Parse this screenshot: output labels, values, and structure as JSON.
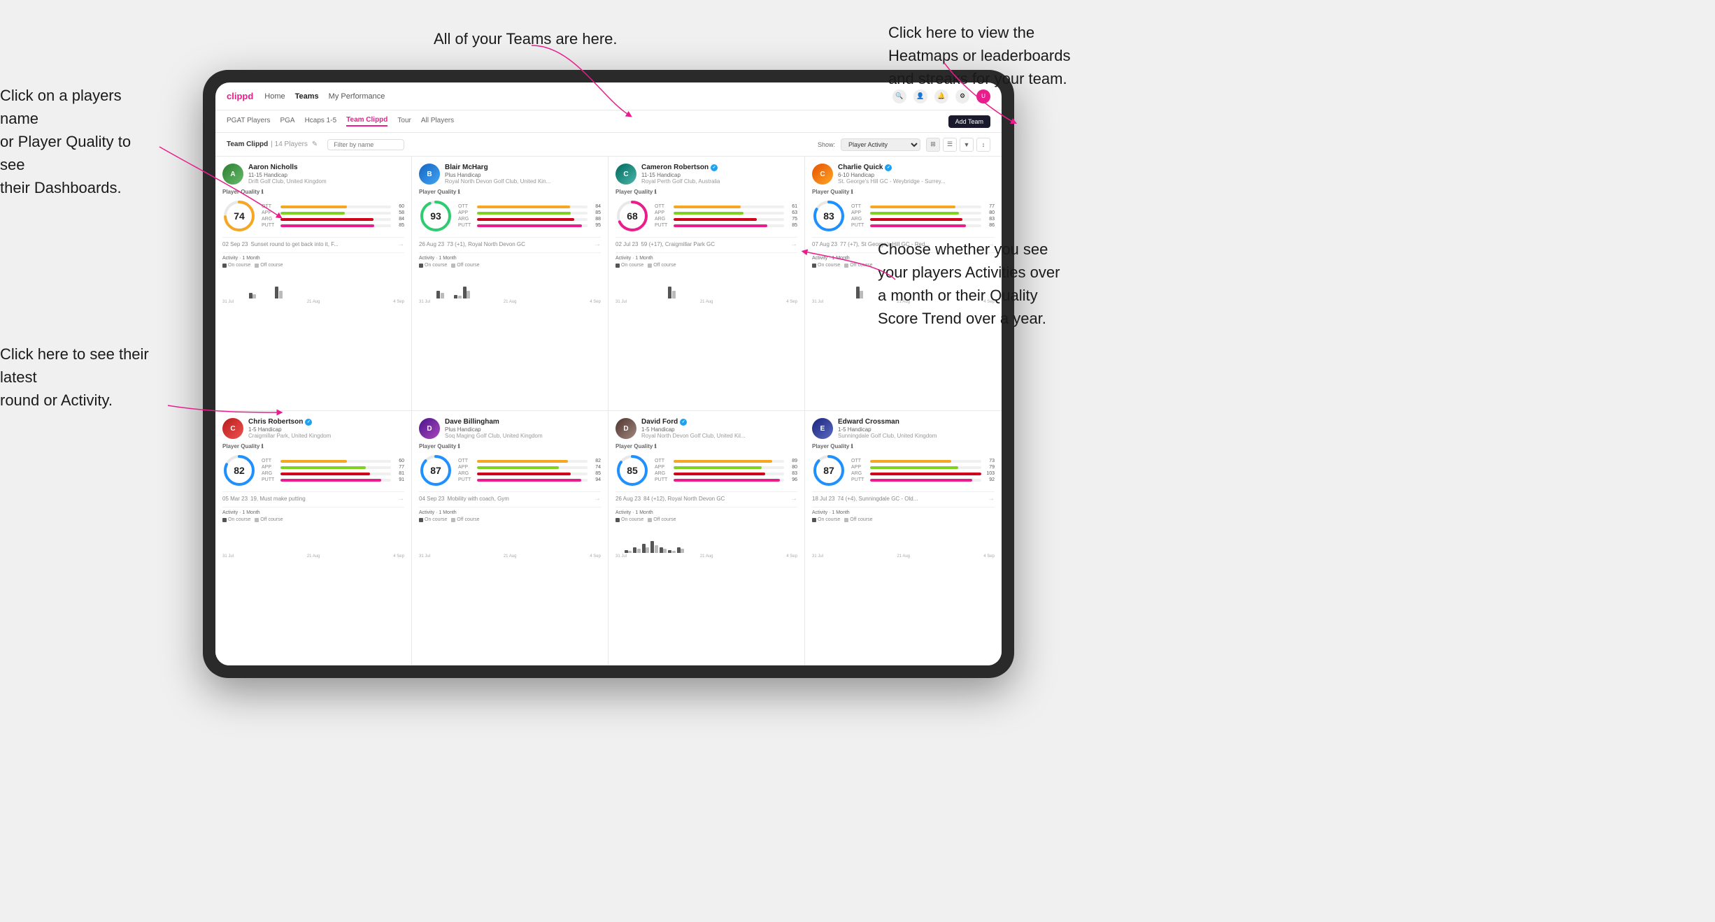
{
  "annotations": {
    "teams_callout": "All of your Teams are here.",
    "heatmaps_callout": "Click here to view the\nHeatmaps or leaderboards\nand streaks for your team.",
    "players_name_callout": "Click on a players name\nor Player Quality to see\ntheir Dashboards.",
    "latest_round_callout": "Click here to see their latest\nround or Activity.",
    "activities_callout": "Choose whether you see\nyour players Activities over\na month or their Quality\nScore Trend over a year."
  },
  "nav": {
    "logo": "clippd",
    "items": [
      "Home",
      "Teams",
      "My Performance"
    ],
    "icons": [
      "search",
      "person",
      "bell",
      "settings",
      "avatar"
    ]
  },
  "sub_nav": {
    "items": [
      "PGAT Players",
      "PGA",
      "Hcaps 1-5",
      "Team Clippd",
      "Tour",
      "All Players"
    ],
    "active": "Team Clippd",
    "add_button": "Add Team"
  },
  "team_bar": {
    "title": "Team Clippd",
    "count": "14 Players",
    "search_placeholder": "Filter by name",
    "show_label": "Show:",
    "show_value": "Player Activity",
    "edit_icon": "✎"
  },
  "players": [
    {
      "name": "Aaron Nicholls",
      "hcp": "11-15 Handicap",
      "club": "Drift Golf Club, United Kingdom",
      "verified": false,
      "score": 74,
      "score_pct": 74,
      "ring_color": "#1e90ff",
      "ott": 60,
      "app": 58,
      "arg": 84,
      "putt": 85,
      "latest_date": "02 Sep 23",
      "latest_text": "Sunset round to get back into it, F...",
      "latest_score": "",
      "activity_bars": [
        0,
        0,
        0,
        1,
        0,
        0,
        2,
        0,
        0
      ],
      "dates": [
        "31 Jul",
        "21 Aug",
        "4 Sep"
      ],
      "avatar_class": "av-green"
    },
    {
      "name": "Blair McHarg",
      "hcp": "Plus Handicap",
      "club": "Royal North Devon Golf Club, United Kin...",
      "verified": false,
      "score": 93,
      "score_pct": 93,
      "ring_color": "#2ecc71",
      "ott": 84,
      "app": 85,
      "arg": 88,
      "putt": 95,
      "latest_date": "26 Aug 23",
      "latest_text": "73 (+1), Royal North Devon GC",
      "latest_score": "73",
      "activity_bars": [
        0,
        0,
        2,
        0,
        1,
        3,
        0,
        0,
        0
      ],
      "dates": [
        "31 Jul",
        "21 Aug",
        "4 Sep"
      ],
      "avatar_class": "av-blue"
    },
    {
      "name": "Cameron Robertson",
      "hcp": "11-15 Handicap",
      "club": "Royal Perth Golf Club, Australia",
      "verified": true,
      "score": 68,
      "score_pct": 68,
      "ring_color": "#1e90ff",
      "ott": 61,
      "app": 63,
      "arg": 75,
      "putt": 85,
      "latest_date": "02 Jul 23",
      "latest_text": "59 (+17), Craigmillar Park GC",
      "latest_score": "59",
      "activity_bars": [
        0,
        0,
        0,
        0,
        0,
        0,
        1,
        0,
        0
      ],
      "dates": [
        "31 Jul",
        "21 Aug",
        "4 Sep"
      ],
      "avatar_class": "av-teal"
    },
    {
      "name": "Charlie Quick",
      "hcp": "6-10 Handicap",
      "club": "St. George's Hill GC - Weybridge - Surrey...",
      "verified": true,
      "score": 83,
      "score_pct": 83,
      "ring_color": "#1e90ff",
      "ott": 77,
      "app": 80,
      "arg": 83,
      "putt": 86,
      "latest_date": "07 Aug 23",
      "latest_text": "77 (+7), St George's Hill GC - Red...",
      "latest_score": "77",
      "activity_bars": [
        0,
        0,
        0,
        0,
        0,
        2,
        0,
        0,
        0
      ],
      "dates": [
        "31 Jul",
        "21 Aug",
        "4 Sep"
      ],
      "avatar_class": "av-orange"
    },
    {
      "name": "Chris Robertson",
      "hcp": "1-5 Handicap",
      "club": "Craigmillar Park, United Kingdom",
      "verified": true,
      "score": 82,
      "score_pct": 82,
      "ring_color": "#1e90ff",
      "ott": 60,
      "app": 77,
      "arg": 81,
      "putt": 91,
      "latest_date": "05 Mar 23",
      "latest_text": "19, Must make putting",
      "latest_score": "",
      "activity_bars": [
        0,
        0,
        0,
        0,
        0,
        0,
        0,
        0,
        0
      ],
      "dates": [
        "31 Jul",
        "21 Aug",
        "4 Sep"
      ],
      "avatar_class": "av-red"
    },
    {
      "name": "Dave Billingham",
      "hcp": "Plus Handicap",
      "club": "Soq Maging Golf Club, United Kingdom",
      "verified": false,
      "score": 87,
      "score_pct": 87,
      "ring_color": "#2ecc71",
      "ott": 82,
      "app": 74,
      "arg": 85,
      "putt": 94,
      "latest_date": "04 Sep 23",
      "latest_text": "Mobility with coach, Gym",
      "latest_score": "",
      "activity_bars": [
        0,
        0,
        0,
        0,
        0,
        0,
        0,
        0,
        0
      ],
      "dates": [
        "31 Jul",
        "21 Aug",
        "4 Sep"
      ],
      "avatar_class": "av-purple"
    },
    {
      "name": "David Ford",
      "hcp": "1-5 Handicap",
      "club": "Royal North Devon Golf Club, United Kil...",
      "verified": true,
      "score": 85,
      "score_pct": 85,
      "ring_color": "#1e90ff",
      "ott": 89,
      "app": 80,
      "arg": 83,
      "putt": 96,
      "latest_date": "26 Aug 23",
      "latest_text": "84 (+12), Royal North Devon GC",
      "latest_score": "84",
      "activity_bars": [
        0,
        1,
        2,
        3,
        4,
        2,
        1,
        2,
        0
      ],
      "dates": [
        "31 Jul",
        "21 Aug",
        "4 Sep"
      ],
      "avatar_class": "av-brown"
    },
    {
      "name": "Edward Crossman",
      "hcp": "1-5 Handicap",
      "club": "Sunningdale Golf Club, United Kingdom",
      "verified": false,
      "score": 87,
      "score_pct": 87,
      "ring_color": "#2ecc71",
      "ott": 73,
      "app": 79,
      "arg": 103,
      "putt": 92,
      "latest_date": "18 Jul 23",
      "latest_text": "74 (+4), Sunningdale GC - Old...",
      "latest_score": "74",
      "activity_bars": [
        0,
        0,
        0,
        0,
        0,
        0,
        0,
        0,
        0
      ],
      "dates": [
        "31 Jul",
        "21 Aug",
        "4 Sep"
      ],
      "avatar_class": "av-indigo"
    }
  ],
  "chart": {
    "activity_label": "Activity · 1 Month",
    "on_course_label": "On course",
    "off_course_label": "Off course",
    "on_course_color": "#555",
    "off_course_color": "#aaa",
    "y_labels": [
      "5",
      "4",
      "3",
      "2",
      "1"
    ]
  }
}
